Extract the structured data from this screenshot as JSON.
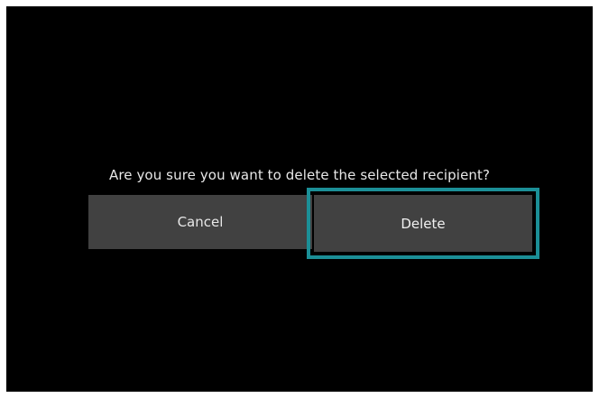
{
  "dialog": {
    "message": "Are you sure you want to delete the selected recipient?",
    "cancel_label": "Cancel",
    "delete_label": "Delete",
    "focus_color": "#1b8f97"
  }
}
